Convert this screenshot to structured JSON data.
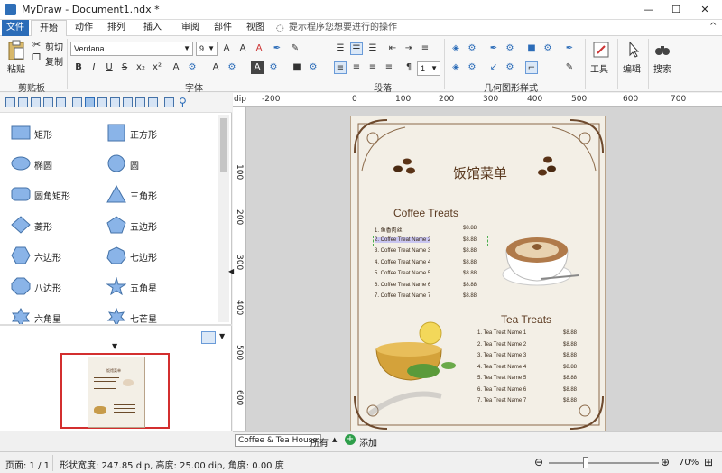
{
  "window": {
    "title": "MyDraw - Document1.ndx *"
  },
  "tabs": [
    {
      "label": "文件"
    },
    {
      "label": "开始"
    },
    {
      "label": "动作"
    },
    {
      "label": "排列"
    },
    {
      "label": "插入"
    },
    {
      "label": "审阅"
    },
    {
      "label": "部件"
    },
    {
      "label": "视图"
    }
  ],
  "search": {
    "placeholder": "提示程序您想要进行的操作"
  },
  "ribbon": {
    "clipboard": {
      "paste": "粘贴",
      "cut": "剪切",
      "copy": "复制",
      "group": "剪贴板"
    },
    "font": {
      "family": "Verdana",
      "size": "9",
      "group": "字体"
    },
    "paragraph": {
      "spacing": "1",
      "group": "段落"
    },
    "geometry": {
      "group": "几何图形样式"
    },
    "tools": {
      "label": "工具"
    },
    "edit": {
      "label": "编辑"
    },
    "find": {
      "label": "搜索"
    }
  },
  "shapes": [
    {
      "label": "矩形",
      "icon": "rectangle-icon"
    },
    {
      "label": "正方形",
      "icon": "square-icon"
    },
    {
      "label": "椭圆",
      "icon": "ellipse-icon"
    },
    {
      "label": "圆",
      "icon": "circle-icon"
    },
    {
      "label": "圆角矩形",
      "icon": "rounded-rect-icon"
    },
    {
      "label": "三角形",
      "icon": "triangle-icon"
    },
    {
      "label": "菱形",
      "icon": "diamond-icon"
    },
    {
      "label": "五边形",
      "icon": "pentagon-icon"
    },
    {
      "label": "六边形",
      "icon": "hexagon-icon"
    },
    {
      "label": "七边形",
      "icon": "heptagon-icon"
    },
    {
      "label": "八边形",
      "icon": "octagon-icon"
    },
    {
      "label": "五角星",
      "icon": "star5-icon"
    },
    {
      "label": "六角星",
      "icon": "star6-icon"
    },
    {
      "label": "七芒星",
      "icon": "star7-icon"
    }
  ],
  "ruler": {
    "unit": "dip",
    "top_ticks": [
      "-200",
      "0",
      "100",
      "200",
      "300",
      "400",
      "500",
      "600",
      "700"
    ],
    "left_ticks": [
      "100",
      "200",
      "300",
      "400",
      "500",
      "600"
    ]
  },
  "document": {
    "menu_title": "饭馆菜单",
    "coffee_title": "Coffee Treats",
    "tea_title": "Tea Treats",
    "coffee_items": [
      {
        "name": "1. 鱼香肉丝",
        "price": "$8.88"
      },
      {
        "name": "2. Coffee Treat Name 2",
        "price": "$8.88"
      },
      {
        "name": "3. Coffee Treat Name 3",
        "price": "$8.88"
      },
      {
        "name": "4. Coffee Treat Name 4",
        "price": "$8.88"
      },
      {
        "name": "5. Coffee Treat Name 5",
        "price": "$8.88"
      },
      {
        "name": "6. Coffee Treat Name 6",
        "price": "$8.88"
      },
      {
        "name": "7. Coffee Treat Name 7",
        "price": "$8.88"
      }
    ],
    "tea_items": [
      {
        "name": "1. Tea Treat Name 1",
        "price": "$8.88"
      },
      {
        "name": "2. Tea Treat Name 2",
        "price": "$8.88"
      },
      {
        "name": "3. Tea Treat Name 3",
        "price": "$8.88"
      },
      {
        "name": "4. Tea Treat Name 4",
        "price": "$8.88"
      },
      {
        "name": "5. Tea Treat Name 5",
        "price": "$8.88"
      },
      {
        "name": "6. Tea Treat Name 6",
        "price": "$8.88"
      },
      {
        "name": "7. Tea Treat Name 7",
        "price": "$8.88"
      }
    ],
    "thumb_title": "饭馆菜单"
  },
  "page_tabs": {
    "current": "Coffee & Tea House",
    "all": "所有",
    "add": "添加"
  },
  "status": {
    "page": "页面: 1 / 1",
    "shape_info": "形状宽度: 247.85 dip, 高度: 25.00 dip, 角度: 0.00 度",
    "zoom": "70%"
  },
  "colors": {
    "accent": "#2b6cb8",
    "selection": "#d32f2f",
    "shape_fill": "#8ab4e8",
    "shape_stroke": "#4472a8"
  }
}
